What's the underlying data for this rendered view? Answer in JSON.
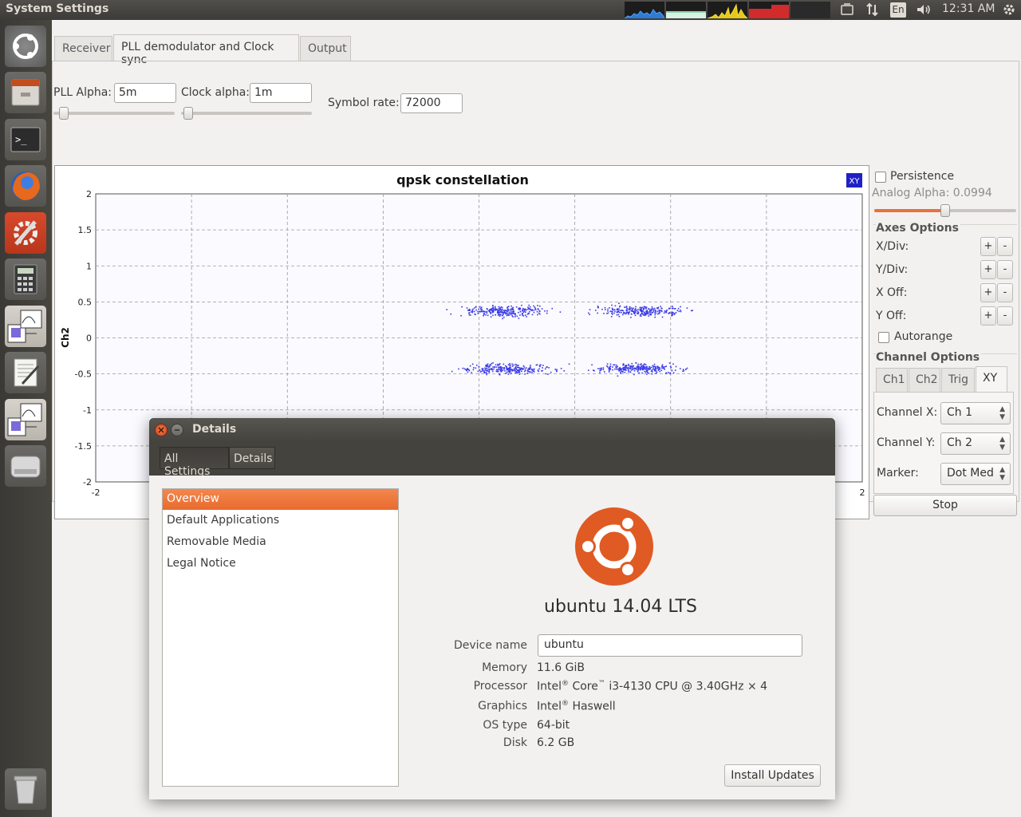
{
  "top_panel": {
    "title": "System Settings",
    "lang": "En",
    "clock": "12:31 AM"
  },
  "launcher": {
    "items": [
      "dash-icon",
      "files-icon",
      "terminal-icon",
      "firefox-icon",
      "system-settings-icon",
      "calculator-icon",
      "gnuradio-companion-icon",
      "text-editor-icon",
      "gnuradio-companion-icon",
      "disk-icon",
      "trash-icon"
    ]
  },
  "main": {
    "tabs": [
      "Receiver",
      "PLL demodulator and Clock sync",
      "Output"
    ],
    "active_tab": 1,
    "pll_alpha_label": "PLL Alpha:",
    "pll_alpha_value": "5m",
    "clock_alpha_label": "Clock alpha:",
    "clock_alpha_value": "1m",
    "symbol_rate_label": "Symbol rate:",
    "symbol_rate_value": "72000"
  },
  "chart_data": {
    "type": "scatter",
    "title": "qpsk constellation",
    "ylabel": "Ch2",
    "xlabel": "",
    "xlim": [
      -2,
      2
    ],
    "ylim": [
      -2,
      2
    ],
    "grid": true,
    "x_ticks": [
      "-2",
      "2"
    ],
    "y_ticks": [
      "2",
      "1.5",
      "1",
      "0.5",
      "0",
      "-0.5",
      "-1",
      "-1.5",
      "-2"
    ],
    "badge": "XY",
    "clusters": [
      {
        "cx": 0.15,
        "cy": 0.38
      },
      {
        "cx": 0.85,
        "cy": 0.38
      },
      {
        "cx": 0.15,
        "cy": -0.42
      },
      {
        "cx": 0.82,
        "cy": -0.42
      }
    ],
    "color": "#3a3ae6"
  },
  "right_panel": {
    "persistence": "Persistence",
    "analog_alpha": "Analog Alpha: 0.0994",
    "analog_alpha_level": 0.5,
    "axes_options": "Axes Options",
    "axes_rows": [
      "X/Div:",
      "Y/Div:",
      "X Off:",
      "Y Off:"
    ],
    "plus": "+",
    "minus": "-",
    "autorange": "Autorange",
    "channel_options": "Channel Options",
    "channel_tabs": [
      "Ch1",
      "Ch2",
      "Trig",
      "XY"
    ],
    "channel_x_label": "Channel X:",
    "channel_x_value": "Ch 1",
    "channel_y_label": "Channel Y:",
    "channel_y_value": "Ch 2",
    "marker_label": "Marker:",
    "marker_value": "Dot Med",
    "stop": "Stop"
  },
  "details": {
    "title": "Details",
    "crumbs": [
      "All Settings",
      "Details"
    ],
    "nav": [
      "Overview",
      "Default Applications",
      "Removable Media",
      "Legal Notice"
    ],
    "os_name": "ubuntu 14.04 LTS",
    "device_name_label": "Device name",
    "device_name_value": "ubuntu",
    "memory_label": "Memory",
    "memory_value": "11.6 GiB",
    "processor_label": "Processor",
    "processor_intel": "Intel",
    "processor_core": "Core",
    "processor_rest": "i3-4130 CPU @ 3.40GHz × 4",
    "trademark_r": "®",
    "trademark_tm": "™",
    "graphics_label": "Graphics",
    "graphics_intel": "Intel",
    "graphics_rest": "Haswell",
    "os_type_label": "OS type",
    "os_type_value": "64-bit",
    "disk_label": "Disk",
    "disk_value": "6.2 GB",
    "install_updates": "Install Updates"
  }
}
